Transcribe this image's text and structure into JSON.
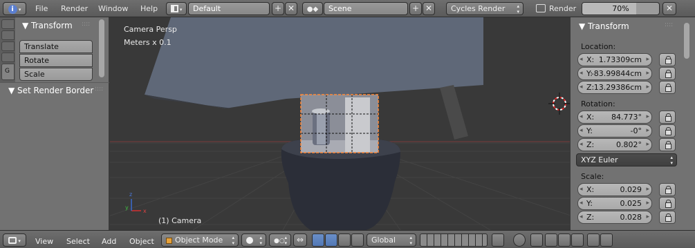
{
  "top_header": {
    "menus": [
      "File",
      "Render",
      "Window",
      "Help"
    ],
    "screen_layout": "Default",
    "scene": "Scene",
    "render_engine": "Cycles Render",
    "render_label": "Render",
    "render_progress_text": "70%",
    "render_progress": 0.7
  },
  "toolshelf": {
    "tab_letter": "G",
    "transform_header": "Transform",
    "buttons": [
      "Translate",
      "Rotate",
      "Scale"
    ],
    "set_render_border_header": "Set Render Border"
  },
  "viewport": {
    "view_name": "Camera Persp",
    "units": "Meters x 0.1",
    "object_label": "(1) Camera"
  },
  "properties": {
    "header": "Transform",
    "location_label": "Location:",
    "location": [
      {
        "axis": "X:",
        "value": "1.73309cm"
      },
      {
        "axis": "Y:",
        "value": "-83.99844cm"
      },
      {
        "axis": "Z:",
        "value": "13.29386cm"
      }
    ],
    "rotation_label": "Rotation:",
    "rotation": [
      {
        "axis": "X:",
        "value": "84.773°"
      },
      {
        "axis": "Y:",
        "value": "-0°"
      },
      {
        "axis": "Z:",
        "value": "0.802°"
      }
    ],
    "rotation_mode": "XYZ Euler",
    "scale_label": "Scale:",
    "scale": [
      {
        "axis": "X:",
        "value": "0.029"
      },
      {
        "axis": "Y:",
        "value": "0.025"
      },
      {
        "axis": "Z:",
        "value": "0.028"
      }
    ]
  },
  "bottom_header": {
    "menus": [
      "View",
      "Select",
      "Add",
      "Object"
    ],
    "mode": "Object Mode",
    "orientation": "Global"
  },
  "colors": {
    "header": "#5f5f5f",
    "panel": "#727272",
    "viewport": "#393939",
    "selection_outline": "#ff8a3a",
    "active_button": "#5278b5"
  }
}
